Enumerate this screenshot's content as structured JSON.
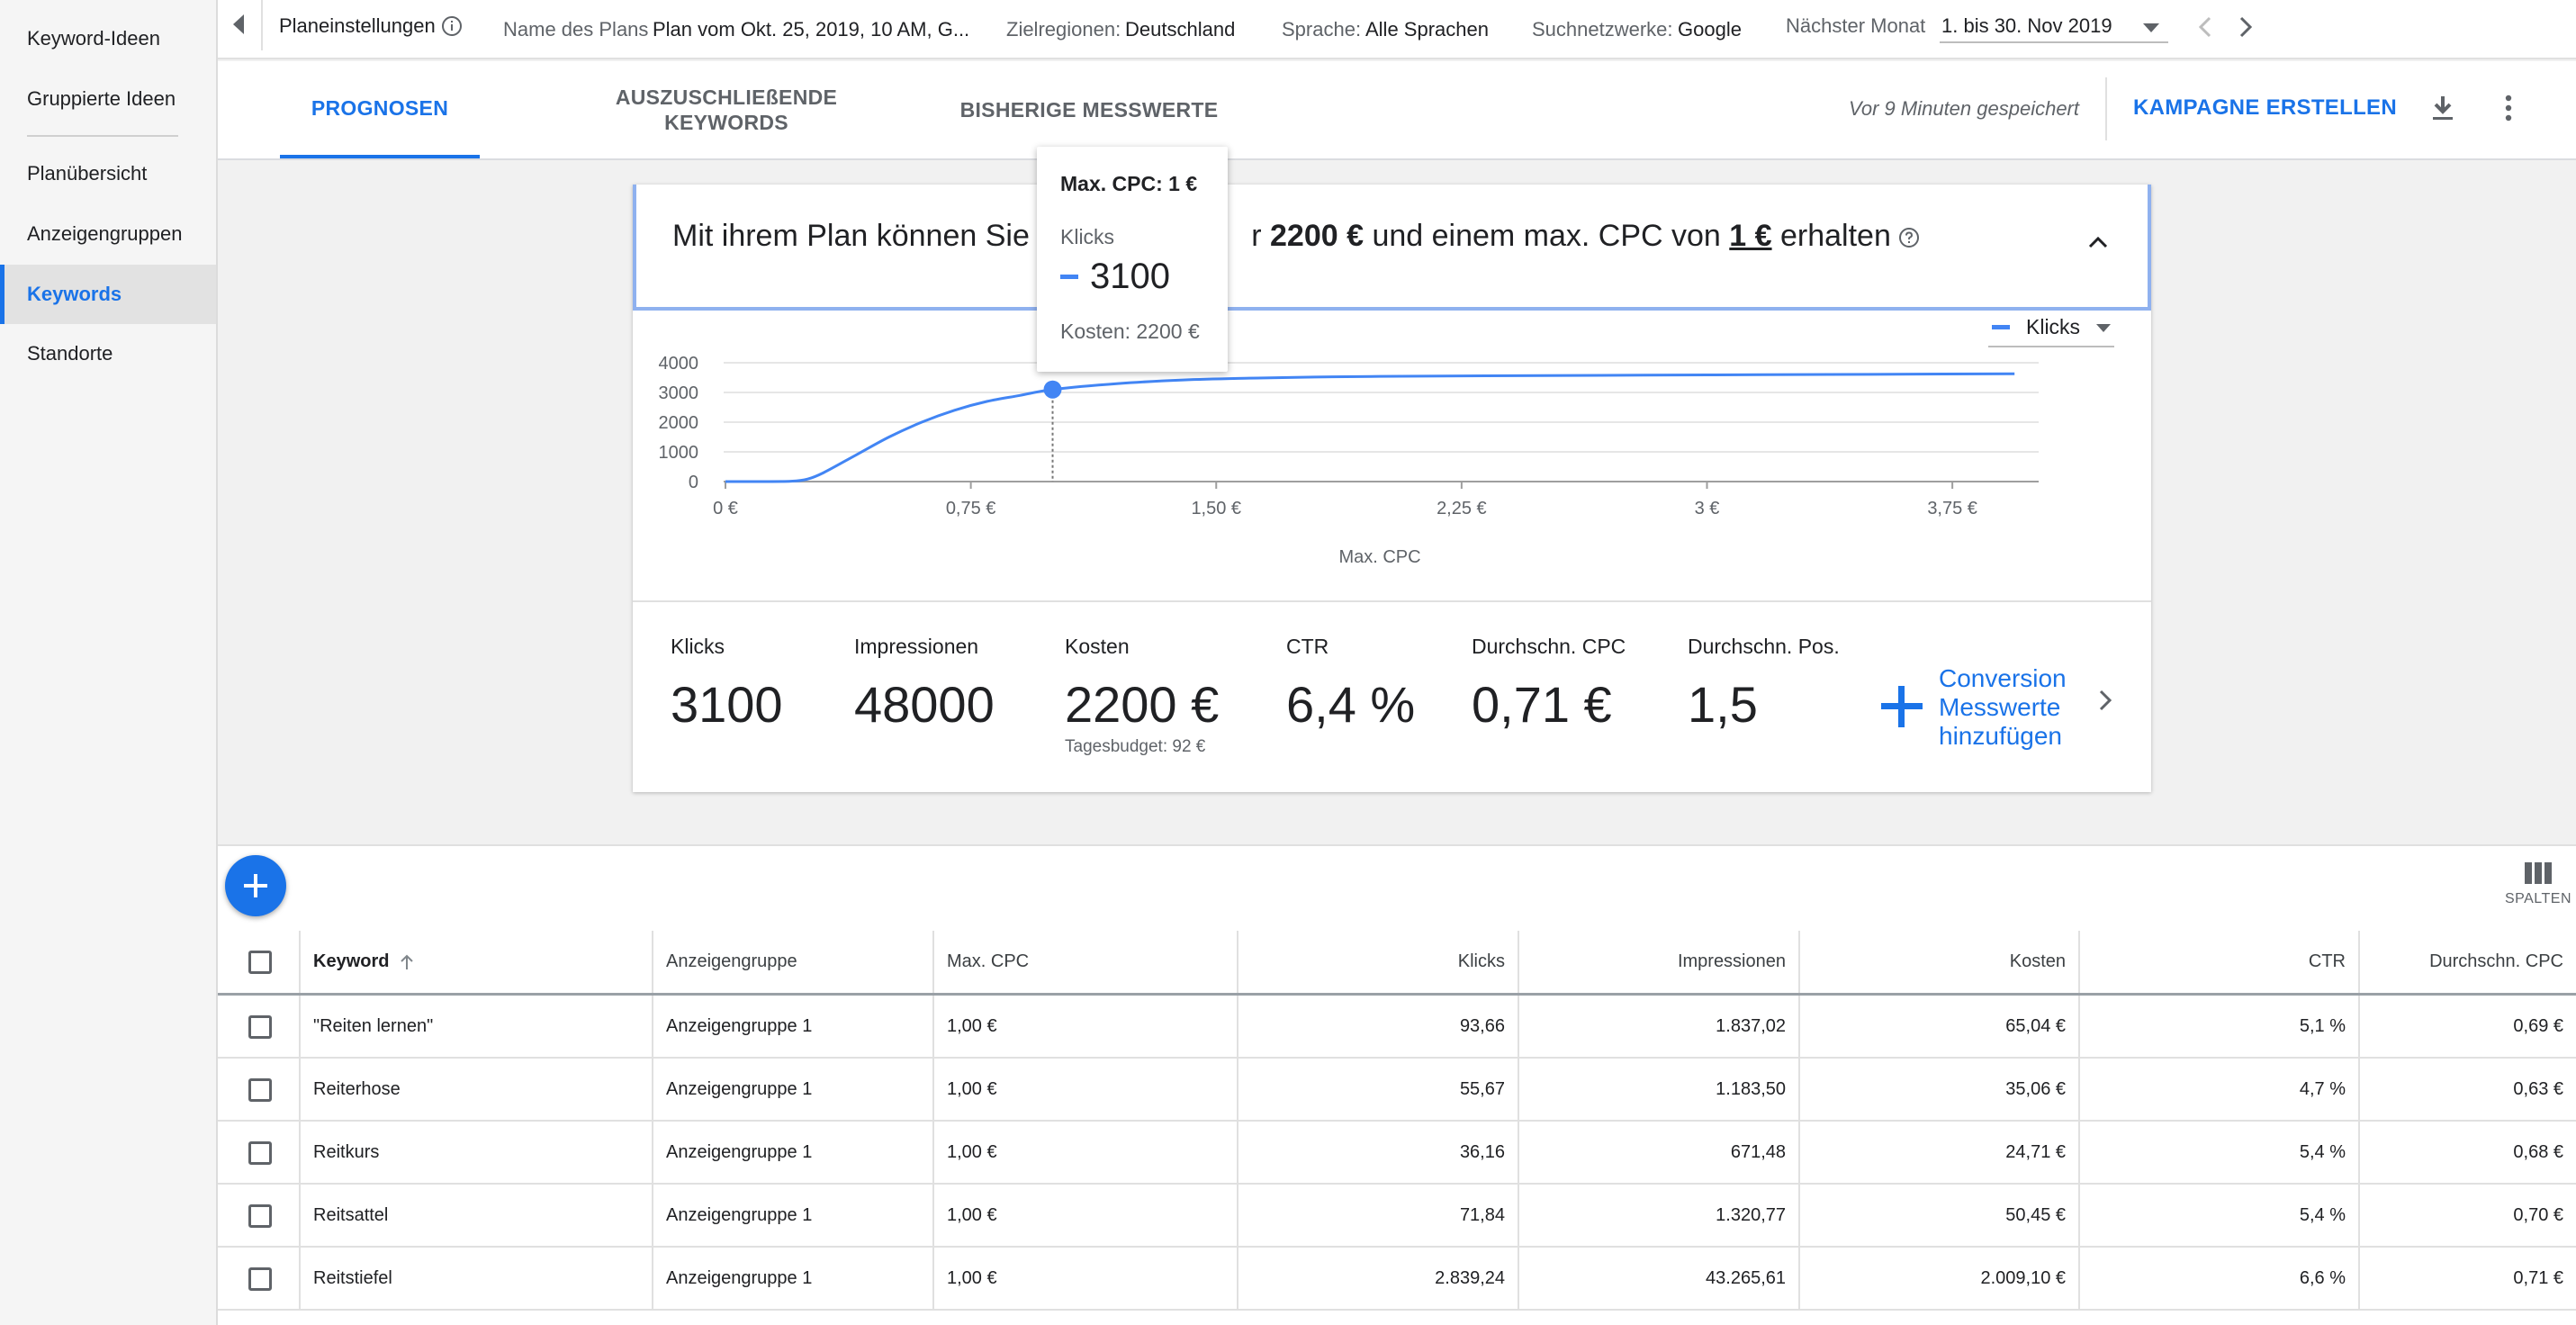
{
  "sidebar": {
    "items": [
      {
        "label": "Keyword-Ideen"
      },
      {
        "label": "Gruppierte Ideen"
      },
      {
        "label": "Planübersicht"
      },
      {
        "label": "Anzeigengruppen"
      },
      {
        "label": "Keywords"
      },
      {
        "label": "Standorte"
      }
    ],
    "active": "Keywords"
  },
  "topbar": {
    "title": "Planeinstellungen",
    "plan_name_label": "Name des Plans",
    "plan_name_value": "Plan vom Okt. 25, 2019, 10 AM, G...",
    "regions_label": "Zielregionen:",
    "regions_value": "Deutschland",
    "language_label": "Sprache:",
    "language_value": "Alle Sprachen",
    "networks_label": "Suchnetzwerke:",
    "networks_value": "Google",
    "month_label": "Nächster Monat",
    "month_value": "1. bis 30. Nov 2019"
  },
  "header": {
    "tabs": [
      {
        "label": "PROGNOSEN"
      },
      {
        "label_line1": "AUSZUSCHLIEßENDE",
        "label_line2": "KEYWORDS"
      },
      {
        "label": "BISHERIGE MESSWERTE"
      }
    ],
    "saved_text": "Vor 9 Minuten gespeichert",
    "create_label": "KAMPAGNE ERSTELLEN"
  },
  "forecast": {
    "headline_part1": "Mit ihrem Plan können Sie 3",
    "headline_part2": "r ",
    "headline_cost": "2200 €",
    "headline_part3": " und einem max. CPC von ",
    "headline_cpc": "1 €",
    "headline_part4": " erhalten",
    "metrics": [
      {
        "label": "Klicks",
        "value": "3100"
      },
      {
        "label": "Impressionen",
        "value": "48000"
      },
      {
        "label": "Kosten",
        "value": "2200 €",
        "sub": "Tagesbudget: 92 €"
      },
      {
        "label": "CTR",
        "value": "6,4 %"
      },
      {
        "label": "Durchschn. CPC",
        "value": "0,71 €"
      },
      {
        "label": "Durchschn. Pos.",
        "value": "1,5"
      }
    ],
    "conversion_line1": "Conversion",
    "conversion_line2": "Messwerte",
    "conversion_line3": "hinzufügen"
  },
  "tooltip": {
    "title": "Max. CPC: 1 €",
    "label": "Klicks",
    "value": "3100",
    "cost": "Kosten: 2200 €"
  },
  "chart_data": {
    "type": "line",
    "xlabel": "Max. CPC",
    "ylabel": "Klicks",
    "xlim": [
      0,
      4
    ],
    "ylim": [
      0,
      4000
    ],
    "x_ticks": [
      0,
      0.75,
      1.5,
      2.25,
      3,
      3.75
    ],
    "x_tick_labels": [
      "0 €",
      "0,75 €",
      "1,50 €",
      "2,25 €",
      "3 €",
      "3,75 €"
    ],
    "y_ticks": [
      0,
      1000,
      2000,
      3000,
      4000
    ],
    "y_tick_labels": [
      "0",
      "1000",
      "2000",
      "3000",
      "4000"
    ],
    "legend": "Klicks",
    "legend_position": "top-right",
    "highlight": {
      "x": 1,
      "y": 3100
    },
    "series": [
      {
        "name": "Klicks",
        "color": "#4285f4",
        "x": [
          0,
          0.1,
          0.2,
          0.25,
          0.3,
          0.4,
          0.5,
          0.6,
          0.7,
          0.8,
          0.9,
          1.0,
          1.2,
          1.4,
          1.6,
          1.8,
          2.0,
          2.5,
          3.0,
          3.5,
          3.94
        ],
        "y": [
          0,
          0,
          10,
          80,
          300,
          900,
          1500,
          2000,
          2400,
          2700,
          2900,
          3100,
          3300,
          3420,
          3480,
          3520,
          3540,
          3570,
          3590,
          3610,
          3630
        ]
      }
    ]
  },
  "table": {
    "columns_label": "SPALTEN",
    "headers": [
      "Keyword",
      "Anzeigengruppe",
      "Max. CPC",
      "Klicks",
      "Impressionen",
      "Kosten",
      "CTR",
      "Durchschn. CPC"
    ],
    "rows": [
      [
        "\"Reiten lernen\"",
        "Anzeigengruppe 1",
        "1,00 €",
        "93,66",
        "1.837,02",
        "65,04 €",
        "5,1 %",
        "0,69 €"
      ],
      [
        "Reiterhose",
        "Anzeigengruppe 1",
        "1,00 €",
        "55,67",
        "1.183,50",
        "35,06 €",
        "4,7 %",
        "0,63 €"
      ],
      [
        "Reitkurs",
        "Anzeigengruppe 1",
        "1,00 €",
        "36,16",
        "671,48",
        "24,71 €",
        "5,4 %",
        "0,68 €"
      ],
      [
        "Reitsattel",
        "Anzeigengruppe 1",
        "1,00 €",
        "71,84",
        "1.320,77",
        "50,45 €",
        "5,4 %",
        "0,70 €"
      ],
      [
        "Reitstiefel",
        "Anzeigengruppe 1",
        "1,00 €",
        "2.839,24",
        "43.265,61",
        "2.009,10 €",
        "6,6 %",
        "0,71 €"
      ]
    ]
  },
  "colors": {
    "accent": "#1a73e8",
    "line": "#4285f4"
  }
}
